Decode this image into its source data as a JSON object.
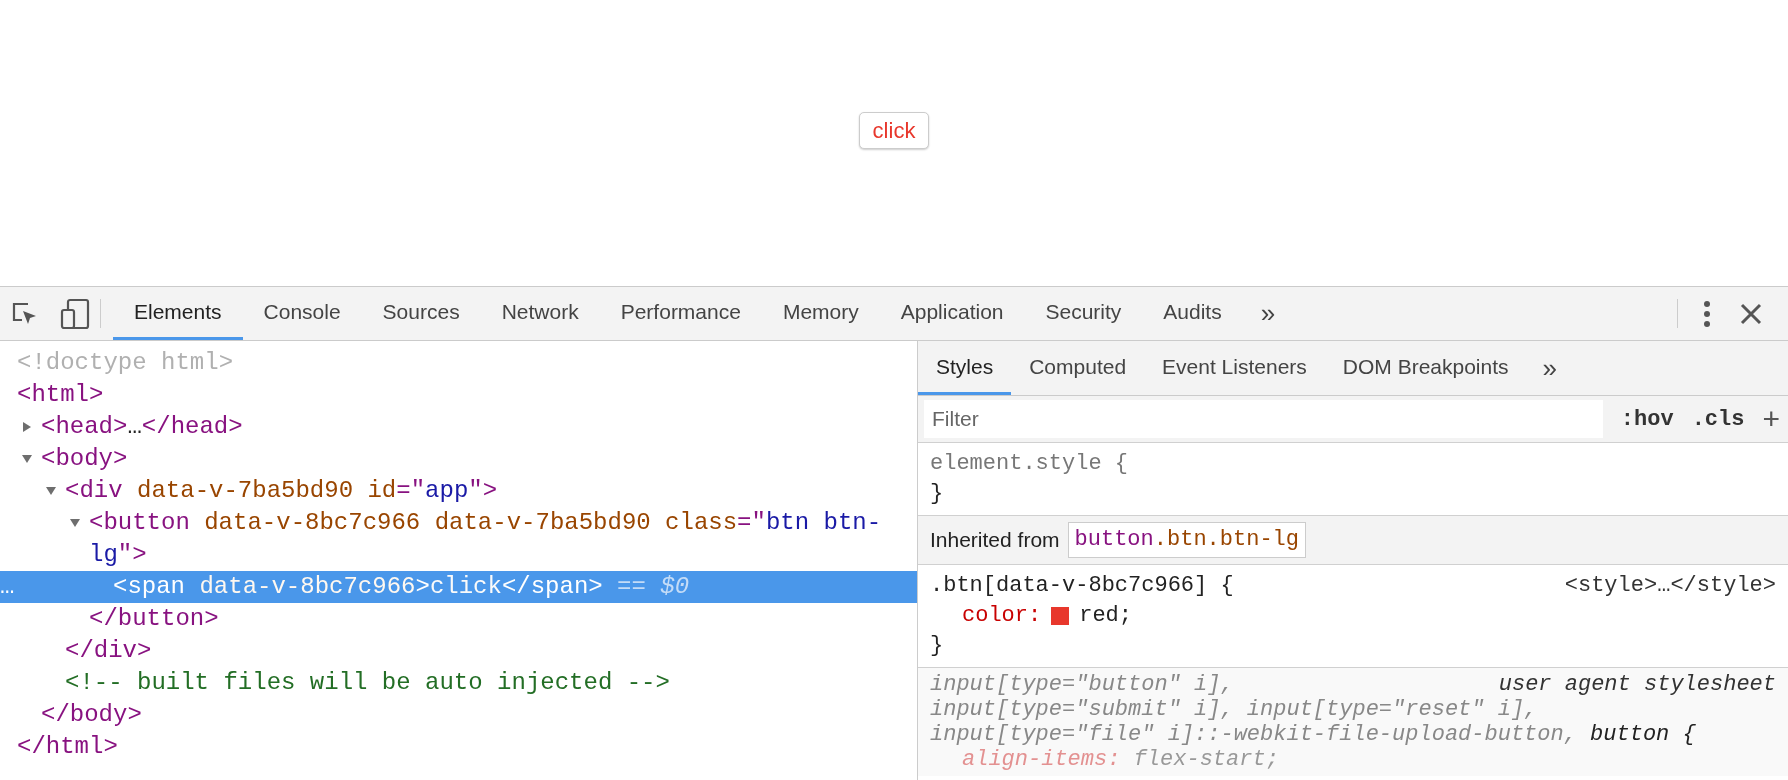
{
  "page": {
    "button": {
      "label": "click"
    }
  },
  "devtools": {
    "tabs": [
      {
        "label": "Elements",
        "selected": true
      },
      {
        "label": "Console",
        "selected": false
      },
      {
        "label": "Sources",
        "selected": false
      },
      {
        "label": "Network",
        "selected": false
      },
      {
        "label": "Performance",
        "selected": false
      },
      {
        "label": "Memory",
        "selected": false
      },
      {
        "label": "Application",
        "selected": false
      },
      {
        "label": "Security",
        "selected": false
      },
      {
        "label": "Audits",
        "selected": false
      }
    ],
    "more_tabs": "»",
    "elements_tree": [
      {
        "selected": false,
        "segments": [
          {
            "kind": "doctype",
            "text": "<!doctype html>"
          }
        ]
      },
      {
        "selected": false,
        "segments": [
          {
            "kind": "tag",
            "text": "<html>"
          }
        ],
        "close": [
          {
            "kind": "tag",
            "text": "</html>"
          }
        ],
        "children": [
          {
            "selected": false,
            "expanded": false,
            "segments": [
              {
                "kind": "tag",
                "text": "<head>"
              },
              {
                "kind": "plain",
                "text": "…"
              },
              {
                "kind": "tag",
                "text": "</head>"
              }
            ]
          },
          {
            "selected": false,
            "expanded": true,
            "segments": [
              {
                "kind": "tag",
                "text": "<body>"
              }
            ],
            "close": [
              {
                "kind": "tag",
                "text": "</body>"
              }
            ],
            "children": [
              {
                "selected": false,
                "expanded": true,
                "segments": [
                  {
                    "kind": "tag",
                    "text": "<div "
                  },
                  {
                    "kind": "attr",
                    "text": "data-v-7ba5bd90 id"
                  },
                  {
                    "kind": "tag",
                    "text": "=\""
                  },
                  {
                    "kind": "value",
                    "text": "app"
                  },
                  {
                    "kind": "tag",
                    "text": "\">"
                  }
                ],
                "close": [
                  {
                    "kind": "tag",
                    "text": "</div>"
                  }
                ],
                "children": [
                  {
                    "selected": false,
                    "expanded": true,
                    "segments": [
                      {
                        "kind": "tag",
                        "text": "<button "
                      },
                      {
                        "kind": "attr",
                        "text": "data-v-8bc7c966 data-v-7ba5bd90 class"
                      },
                      {
                        "kind": "tag",
                        "text": "=\""
                      },
                      {
                        "kind": "value",
                        "text": "btn btn-lg"
                      },
                      {
                        "kind": "tag",
                        "text": "\">"
                      }
                    ],
                    "close": [
                      {
                        "kind": "tag",
                        "text": "</button>"
                      }
                    ],
                    "children": [
                      {
                        "selected": true,
                        "gutter": "…",
                        "segments": [
                          {
                            "kind": "tag",
                            "text": "<span "
                          },
                          {
                            "kind": "attr",
                            "text": "data-v-8bc7c966"
                          },
                          {
                            "kind": "tag",
                            "text": ">"
                          },
                          {
                            "kind": "plain",
                            "text": "click"
                          },
                          {
                            "kind": "tag",
                            "text": "</span>"
                          }
                        ],
                        "suffix": "== $0"
                      }
                    ]
                  }
                ]
              },
              {
                "selected": false,
                "segments": [
                  {
                    "kind": "comment",
                    "text": "<!-- built files will be auto injected -->"
                  }
                ]
              }
            ]
          }
        ]
      }
    ],
    "styles_panel": {
      "tabs": [
        {
          "label": "Styles",
          "selected": true
        },
        {
          "label": "Computed",
          "selected": false
        },
        {
          "label": "Event Listeners",
          "selected": false
        },
        {
          "label": "DOM Breakpoints",
          "selected": false
        }
      ],
      "more_tabs": "»",
      "filter": {
        "placeholder": "Filter"
      },
      "toggles": [
        ":hov",
        ".cls"
      ],
      "add": "+",
      "sections": [
        {
          "kind": "rule",
          "selector": "element.style {",
          "close": "}"
        },
        {
          "kind": "inherited",
          "label": "Inherited from",
          "chip": [
            {
              "kind": "tag",
              "text": "button"
            },
            {
              "kind": "class",
              "text": ".btn.btn-lg"
            }
          ]
        },
        {
          "kind": "rule",
          "selector": ".btn[data-v-8bc7c966] {",
          "source": "<style>…</style>",
          "close": "}",
          "properties": [
            {
              "name": "color:",
              "value": "red;",
              "color": "#e8372c"
            }
          ]
        },
        {
          "kind": "ua_rule",
          "source": "user agent stylesheet",
          "selector_lines": [
            [
              {
                "text": "input[type=\"button\" i],",
                "matched": false
              }
            ],
            [
              {
                "text": "input[type=\"submit\" i], input[type=\"reset\" i],",
                "matched": false
              }
            ],
            [
              {
                "text": "input[type=\"file\" i]::-webkit-file-upload-button, ",
                "matched": false
              },
              {
                "text": "button {",
                "matched": true
              }
            ]
          ],
          "properties": [
            {
              "name": "align-items:",
              "value": "flex-start;"
            }
          ]
        }
      ]
    }
  }
}
